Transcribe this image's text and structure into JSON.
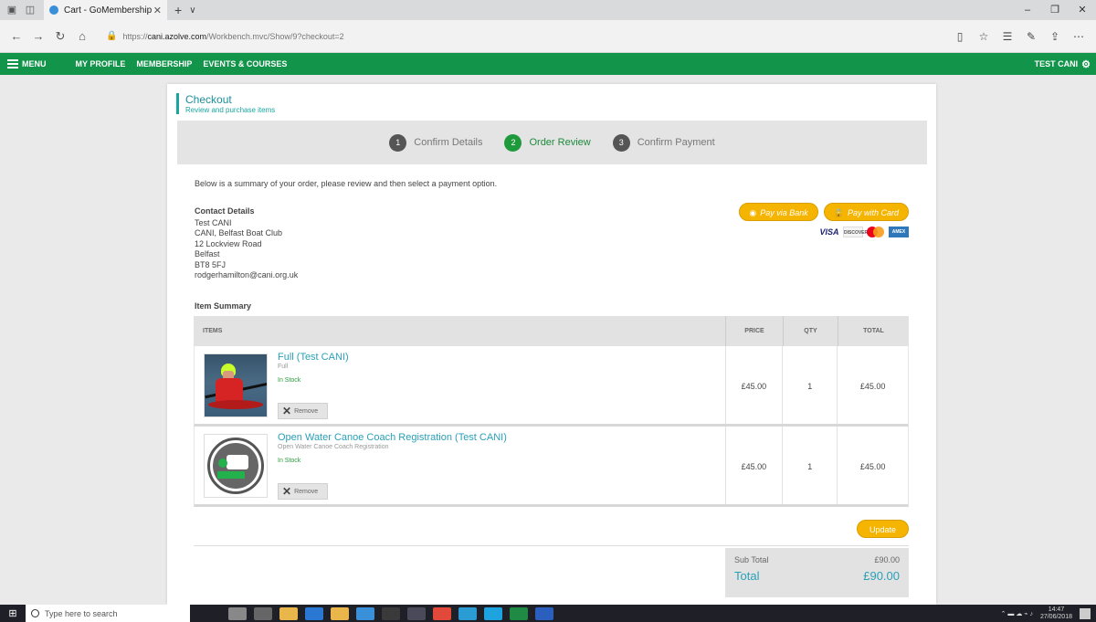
{
  "browser": {
    "tab_title": "Cart - GoMembership",
    "tab_close": "✕",
    "new_tab": "+",
    "tab_list": "∨",
    "url_domain": "cani.azolve.com",
    "url_prefix": "https://",
    "url_path": "/Workbench.mvc/Show/9?checkout=2"
  },
  "sitenav": {
    "menu_label": "MENU",
    "links": [
      "MY PROFILE",
      "MEMBERSHIP",
      "EVENTS & COURSES"
    ],
    "user_label": "TEST CANI"
  },
  "checkout": {
    "title": "Checkout",
    "subtitle": "Review and purchase items",
    "steps": [
      {
        "num": "1",
        "label": "Confirm Details"
      },
      {
        "num": "2",
        "label": "Order Review"
      },
      {
        "num": "3",
        "label": "Confirm Payment"
      }
    ],
    "intro": "Below is a summary of your order, please review and then select a payment option.",
    "contact_label": "Contact Details",
    "contact_lines": [
      "Test CANI",
      "CANI, Belfast Boat Club",
      "12 Lockview Road",
      "Belfast",
      "BT8 5FJ",
      "rodgerhamilton@cani.org.uk"
    ],
    "pay_bank": "Pay via Bank",
    "pay_card": "Pay with Card",
    "card_logos": {
      "visa": "VISA",
      "discover": "DISCOVER",
      "amex": "AMEX"
    },
    "item_summary_label": "Item Summary",
    "columns": {
      "items": "ITEMS",
      "price": "PRICE",
      "qty": "QTY",
      "total": "TOTAL"
    },
    "items": [
      {
        "name": "Full (Test CANI)",
        "sub": "Full",
        "stock": "In Stock",
        "price": "£45.00",
        "qty": "1",
        "total": "£45.00",
        "remove": "Remove"
      },
      {
        "name": "Open Water Canoe Coach Registration (Test CANI)",
        "sub": "Open Water Canoe Coach Registration",
        "stock": "In Stock",
        "price": "£45.00",
        "qty": "1",
        "total": "£45.00",
        "remove": "Remove"
      }
    ],
    "update_label": "Update",
    "subtotal_label": "Sub Total",
    "subtotal_value": "£90.00",
    "total_label": "Total",
    "total_value": "£90.00"
  },
  "taskbar": {
    "search_placeholder": "Type here to search",
    "time": "14:47",
    "date": "27/06/2018"
  },
  "colors": {
    "brand_green": "#12944a",
    "teal": "#1aa6a0",
    "accent_orange": "#f5b400"
  }
}
